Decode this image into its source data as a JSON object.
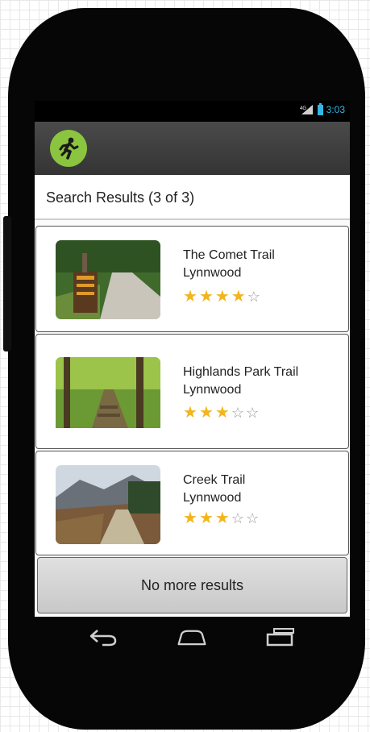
{
  "status_bar": {
    "time": "3:03",
    "signal_icon": "signal-icon",
    "battery_icon": "battery-icon"
  },
  "action_bar": {
    "app_icon": "running-person-icon",
    "accent_color": "#8bc43f"
  },
  "results": {
    "title": "Search Results (3 of 3)",
    "items": [
      {
        "name": "The Comet Trail",
        "location": "Lynnwood",
        "rating": 4,
        "max_rating": 5,
        "photo": "trail-photo"
      },
      {
        "name": "Highlands Park Trail",
        "location": "Lynnwood",
        "rating": 3,
        "max_rating": 5,
        "photo": "forest-photo"
      },
      {
        "name": "Creek Trail",
        "location": "Lynnwood",
        "rating": 3,
        "max_rating": 5,
        "photo": "mountain-photo"
      }
    ]
  },
  "footer": {
    "no_more_label": "No more results"
  },
  "nav_bar": {
    "back_icon": "back-icon",
    "home_icon": "home-icon",
    "recents_icon": "recent-apps-icon"
  }
}
